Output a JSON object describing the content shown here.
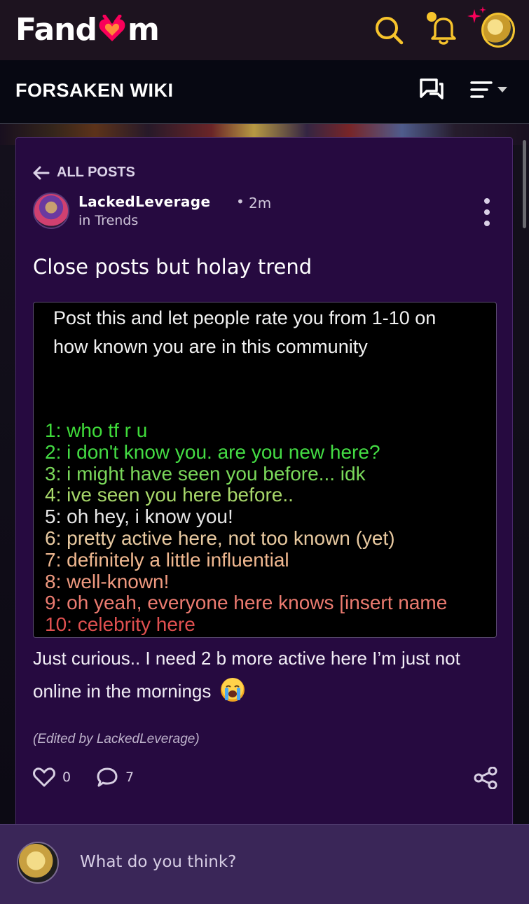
{
  "header": {
    "logo_text_left": "Fand",
    "logo_text_right": "m",
    "brand_color": "#fa005a",
    "accent_color": "#f7c42c"
  },
  "wiki": {
    "title": "FORSAKEN WIKI"
  },
  "post": {
    "back_label": "ALL POSTS",
    "author": "LackedLeverage",
    "separator": "•",
    "time": "2m",
    "category": "in Trends",
    "title": "Close posts but holay trend",
    "image": {
      "heading": "Post this and let people rate you from 1-10 on how known you are in this community",
      "lines": [
        {
          "text": "1: who tf r u",
          "color": "#3fdc3a"
        },
        {
          "text": "2: i don't know you. are you new here?",
          "color": "#44dc44"
        },
        {
          "text": "3: i might have seen you before... idk",
          "color": "#7ad85a"
        },
        {
          "text": "4: ive seen you here before..",
          "color": "#a8d86a"
        },
        {
          "text": "5: oh hey, i know you!",
          "color": "#e6e6e6"
        },
        {
          "text": "6: pretty active here, not too known (yet)",
          "color": "#e8c9a0"
        },
        {
          "text": "7: definitely a little influential",
          "color": "#f0b890"
        },
        {
          "text": "8: well-known!",
          "color": "#f09a80"
        },
        {
          "text": "9: oh yeah, everyone here knows [insert name",
          "color": "#ec7b70"
        },
        {
          "text": "10: celebrity here",
          "color": "#e05050"
        }
      ]
    },
    "body": "Just curious.. I need 2 b more active here I’m just not online in the mornings",
    "emoji": "loudly-crying-face",
    "edited": "(Edited by LackedLeverage)",
    "likes": "0",
    "comments": "7"
  },
  "comment_box": {
    "placeholder": "What do you think?"
  }
}
